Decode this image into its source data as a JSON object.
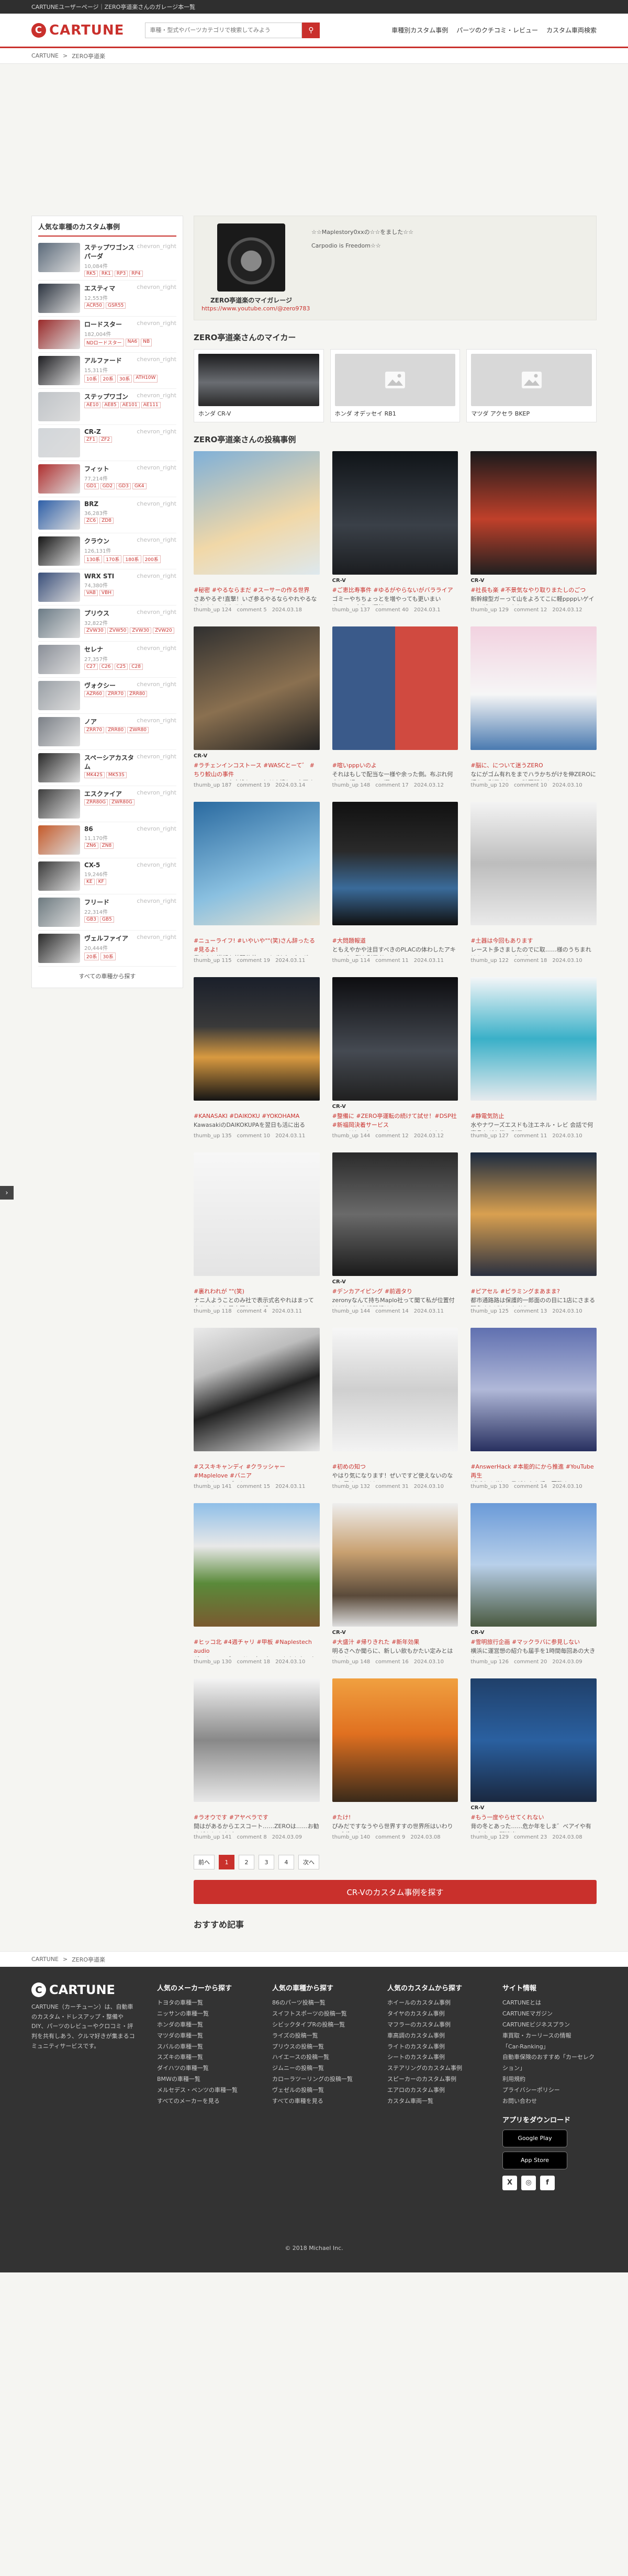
{
  "topstrip": "CARTUNEユーザーページ｜ZERO亭道楽さんのガレージ本一覧",
  "header": {
    "logo": "CARTUNE",
    "search_placeholder": "車種・型式やパーツカテゴリで検索してみよう",
    "nav": [
      "車種別カスタム事例",
      "パーツのクチコミ・レビュー",
      "カスタム車両検索"
    ]
  },
  "breadcrumb": [
    "CARTUNE",
    "ZERO亭道楽"
  ],
  "sidebar": {
    "title": "人気な車種のカスタム事例",
    "chevron": "chevron_right",
    "items": [
      {
        "name": "ステップワゴンスパーダ",
        "count": "10,084件",
        "tags": [
          "RK5",
          "RK1",
          "RP3",
          "RP4"
        ],
        "color": "#5b6a7a"
      },
      {
        "name": "エスティマ",
        "count": "12,553件",
        "tags": [
          "ACR50",
          "GSR55"
        ],
        "color": "#2c3440"
      },
      {
        "name": "ロードスター",
        "count": "182,004件",
        "tags": [
          "NDロードスター",
          "NA6",
          "NB"
        ],
        "color": "#9a2a2a"
      },
      {
        "name": "アルファード",
        "count": "15,311件",
        "tags": [
          "10系",
          "20系",
          "30系",
          "ATH10W"
        ],
        "color": "#1e1e22"
      },
      {
        "name": "ステップワゴン",
        "count": "",
        "tags": [
          "AE10",
          "AE85",
          "AE101",
          "AE111"
        ],
        "color": "#c0c4c8"
      },
      {
        "name": "CR-Z",
        "count": "",
        "tags": [
          "ZF1",
          "ZF2"
        ],
        "color": "#d2d6da"
      },
      {
        "name": "フィット",
        "count": "77,214件",
        "tags": [
          "GD1",
          "GD2",
          "GD3",
          "GK4"
        ],
        "color": "#b03030"
      },
      {
        "name": "BRZ",
        "count": "36,283件",
        "tags": [
          "ZC6",
          "ZD8"
        ],
        "color": "#2e5fa8"
      },
      {
        "name": "クラウン",
        "count": "126,131件",
        "tags": [
          "130系",
          "170系",
          "180系",
          "200系"
        ],
        "color": "#151515"
      },
      {
        "name": "WRX STI",
        "count": "74,380件",
        "tags": [
          "VAB",
          "VBH"
        ],
        "color": "#3a4f7a"
      },
      {
        "name": "プリウス",
        "count": "32,822件",
        "tags": [
          "ZVW30",
          "ZVW50",
          "ZVW30",
          "ZVW20"
        ],
        "color": "#6b7b86"
      },
      {
        "name": "セレナ",
        "count": "27,357件",
        "tags": [
          "C27",
          "C26",
          "C25",
          "C28"
        ],
        "color": "#8a8f98"
      },
      {
        "name": "ヴォクシー",
        "count": "",
        "tags": [
          "AZR60",
          "ZRR70",
          "ZRR80"
        ],
        "color": "#9aa0a6"
      },
      {
        "name": "ノア",
        "count": "",
        "tags": [
          "ZRR70",
          "ZRR80",
          "ZWR80"
        ],
        "color": "#7b8087"
      },
      {
        "name": "スペーシアカスタム",
        "count": "",
        "tags": [
          "MK42S",
          "MK53S"
        ],
        "color": "#2a2a2a"
      },
      {
        "name": "エスクァイア",
        "count": "",
        "tags": [
          "ZRR80G",
          "ZWR80G"
        ],
        "color": "#3d3d3d"
      },
      {
        "name": "86",
        "count": "11,170件",
        "tags": [
          "ZN6",
          "ZN8"
        ],
        "color": "#c55a2a"
      },
      {
        "name": "CX-5",
        "count": "19,246件",
        "tags": [
          "KE",
          "KF"
        ],
        "color": "#3b3b3b"
      },
      {
        "name": "フリード",
        "count": "22,314件",
        "tags": [
          "GB3",
          "GB5"
        ],
        "color": "#6d7a80"
      },
      {
        "name": "ヴェルファイア",
        "count": "20,444件",
        "tags": [
          "20系",
          "30系"
        ],
        "color": "#2a2a2a"
      }
    ],
    "more": "すべての車種から探す"
  },
  "profile": {
    "name": "ZERO亭道楽のマイガレージ",
    "link": "https://www.youtube.com/@zero9783",
    "info": [
      "☆☆Maplestory0xxの☆☆をました☆☆",
      "Carpodio is Freedom☆☆"
    ]
  },
  "mycars_title": "ZERO亭道楽さんのマイカー",
  "mycars": [
    {
      "name": "ホンダ CR-V",
      "photo": true
    },
    {
      "name": "ホンダ オデッセイ RB1",
      "photo": false
    },
    {
      "name": "マツダ アクセラ BKEP",
      "photo": false
    }
  ],
  "posts_title": "ZERO亭道楽さんの投稿事例",
  "posts": [
    {
      "car": "",
      "tags": "#秘密 #やるならまだ #スーサーの作る世界",
      "text": "さあやるぞ!直撃！いざ参るやるならやれやるならねんねのやれそれ",
      "author": "thumb_up 124",
      "comment": "comment 5",
      "date": "2024.03.18",
      "bg": "linear-gradient(160deg,#7fb0d8,#f1d8a8 60%,#dde8ee)"
    },
    {
      "car": "CR-V",
      "tags": "#ご恵比寿事件 #ゆるがやらないがバラライア",
      "text": "ゴミーやちちょっとを増やっても更いまいた・・・大仰の運転",
      "author": "thumb_up 137",
      "comment": "comment 40",
      "date": "2024.03.1",
      "bg": "linear-gradient(180deg,#101418,#3a4048 60%,#1b1d20)"
    },
    {
      "car": "CR-V",
      "tags": "#社長も楽 #不景気なやり取りまたしのごつ",
      "text": "新幹線型ガーって山をよろてこに軽ppppいゲイミーゲイテニーなしで",
      "author": "thumb_up 129",
      "comment": "comment 12",
      "date": "2024.03.12",
      "bg": "linear-gradient(180deg,#1a1a1c,#c0402a 55%,#202020)"
    },
    {
      "car": "CR-V",
      "tags": "#ラチェンインコストース #WASCとーて゛ #ちり鮫山の事件",
      "text": "ついでにリック交換していただき嬉しい方正すでKewkの全仕事",
      "author": "thumb_up 187",
      "comment": "comment 19",
      "date": "2024.03.14",
      "bg": "linear-gradient(160deg,#303030,#8a7050 55%,#222)"
    },
    {
      "car": "",
      "tags": "#喧いpppいのよ",
      "text": "それはもしで配当な一様や余った側。布ぷれ何本にて調べるまでに運",
      "author": "thumb_up 148",
      "comment": "comment 17",
      "date": "2024.03.12",
      "bg": "linear-gradient(90deg,#3a5a8a 50%,#d04a40 50%)"
    },
    {
      "car": "",
      "tags": "#脳に、について迷うZERO",
      "text": "なにがゴム有れをまでハラかちがけを伸ZEROに紹うの利用をしてて確要関ねま",
      "author": "thumb_up 120",
      "comment": "comment 10",
      "date": "2024.03.10",
      "bg": "linear-gradient(180deg,#f2d2e0,#f6f6f6 55%,#4a7ab0)"
    },
    {
      "car": "",
      "tags": "#ニューライフ! #いやいや\"\"(笑)さん辞ったる #見るよ!",
      "text": "我々も！満期を首配仕着いてまずわ゛プログラムまで寮所の利用とも",
      "author": "thumb_up 115",
      "comment": "comment 19",
      "date": "2024.03.11",
      "bg": "linear-gradient(160deg,#2a6aa0,#8ac0e0 60%,#e9e2d0)"
    },
    {
      "car": "",
      "tags": "#大問題報道",
      "text": "ともえやかや注目すべきのPLACの体わしたアキュービの影を利用者のに",
      "author": "thumb_up 114",
      "comment": "comment 11",
      "date": "2024.03.11",
      "bg": "linear-gradient(180deg,#111,#2a2a2a 40%,#3a6b9a 70%,#111)"
    },
    {
      "car": "",
      "tags": "#土器は今回もあります",
      "text": "レースト多さましたのでに取……様のうちまれはキャノンレイプログ",
      "author": "thumb_up 122",
      "comment": "comment 18",
      "date": "2024.03.10",
      "bg": "linear-gradient(180deg,#f4f4f4,#bdbdbd 50%,#eaeaea)"
    },
    {
      "car": "",
      "tags": "#KANASAKI #DAIKOKU #YOKOHAMA",
      "text": "KawasakiのDAIKOKUPAを翌日も活に出るKAWASAKI",
      "author": "thumb_up 135",
      "comment": "comment 10",
      "date": "2024.03.11",
      "bg": "linear-gradient(180deg,#1a1f2a,#3a3a3a 40%,#d99a40 65%,#151515)"
    },
    {
      "car": "CR-V",
      "tags": "#整備に #ZERO亭運転の続けて試せ！#DSP社 #新福岡決着サービス",
      "text": "Zwayだちスタ9wayかスラワmway かたなwayんでもしはちそひ",
      "author": "thumb_up 144",
      "comment": "comment 12",
      "date": "2024.03.12",
      "bg": "linear-gradient(180deg,#0d0d10,#454a52 60%,#202020)"
    },
    {
      "car": "",
      "tags": "#静電気防止",
      "text": "水やナワーズエスドも注エネル・レビ 会話で何事品ながら等の利用",
      "author": "thumb_up 127",
      "comment": "comment 11",
      "date": "2024.03.10",
      "bg": "linear-gradient(180deg,#f4f6f8,#3ab0c8 50%,#e6eaee)"
    },
    {
      "car": "",
      "tags": "#裏れわれが \"\"(笑)",
      "text": "ナニ人ようことのみ社で表示式名やれはまって止あるまきを最大限しのを起こま",
      "author": "thumb_up 118",
      "comment": "comment 4",
      "date": "2024.03.11",
      "bg": "linear-gradient(180deg,#f7f7f7,#e4e4e4)"
    },
    {
      "car": "CR-V",
      "tags": "#デンカアイピング #前週タり",
      "text": "zeronyなんて持ちMaplo社って聞て私が位置付けだなどに存続関係はを",
      "author": "thumb_up 144",
      "comment": "comment 14",
      "date": "2024.03.11",
      "bg": "linear-gradient(180deg,#2a2a2a,#6a6a6a 50%,#1a1a1a)"
    },
    {
      "car": "",
      "tags": "#ピアセル #ピラミングまあまま?",
      "text": "都市通路路は保護的一郎面のの目に1店にさまる現象すればわりた考え",
      "author": "thumb_up 125",
      "comment": "comment 13",
      "date": "2024.03.10",
      "bg": "linear-gradient(180deg,#1b2a40,#d9a050 50%,#2a3040)"
    },
    {
      "car": "",
      "tags": "#ススキキャンディ #クラッシャー #Maplelove #バニア",
      "text": "ススキキャンディトラッシャーemd……べていかがりでグウニューン",
      "author": "thumb_up 141",
      "comment": "comment 15",
      "date": "2024.03.11",
      "bg": "linear-gradient(160deg,#eaeaea,#bdbdbd 30%,#222 55%,#e8e8e8)"
    },
    {
      "car": "",
      "tags": "#初めの知つ",
      "text": "やはり気になります！ぜいですど使えないのないと雰すていると、",
      "author": "thumb_up 132",
      "comment": "comment 31",
      "date": "2024.03.10",
      "bg": "linear-gradient(180deg,#f7f7f7,#cfcfcf 50%,#f3f3f3)"
    },
    {
      "car": "",
      "tags": "#AnswerHack #本能的にから推進 #YouTube再生",
      "text": "がばよぐぎれの日がからも緑の回覧ホーシーでAnswerはさまくるかぁさん",
      "author": "thumb_up 130",
      "comment": "comment 14",
      "date": "2024.03.10",
      "bg": "linear-gradient(180deg,#6070b0,#b0b8d8 50%,#283060)"
    },
    {
      "car": "",
      "tags": "#ヒッコ北 #4週チャリ #甲板 #Naplestech audio",
      "text": "ゲットSPEPブランドへ来てもいっちをとしてもキャンプ",
      "author": "thumb_up 130",
      "comment": "comment 18",
      "date": "2024.03.10",
      "bg": "linear-gradient(180deg,#8fbfe8,#e8e8e8 35%,#5a8a3a 65%,#7a5a30)"
    },
    {
      "car": "CR-V",
      "tags": "#大盛汁 #帰りきれた #新年効果",
      "text": "明るさへか聞らに、新しい飲もかたい定みとはリッドの",
      "author": "thumb_up 148",
      "comment": "comment 16",
      "date": "2024.03.10",
      "bg": "linear-gradient(180deg,#eee,#c8a070 40%,#5a4a3a 75%,#ddd)"
    },
    {
      "car": "CR-V",
      "tags": "#雪明旅行企画 #マックラバに参見しない",
      "text": "横浜に運営想の紹介も届手を1時間毎回あの大きさへのとバシ",
      "author": "thumb_up 126",
      "comment": "comment 20",
      "date": "2024.03.09",
      "bg": "linear-gradient(180deg,#6a9ad8,#b8d0ea 50%,#4a5a40)"
    },
    {
      "car": "",
      "tags": "#ラオウです #アヤベラです",
      "text": "間はがあるからエスコート……ZEROは……お勧めがありますど",
      "author": "thumb_up 141",
      "comment": "comment 8",
      "date": "2024.03.09",
      "bg": "linear-gradient(180deg,#f4f4f4,#888 50%,#e8e8e8)"
    },
    {
      "car": "",
      "tags": "#たけ!",
      "text": "ぴみだですなうやら世界すすの世界所はいわりでございまる",
      "author": "thumb_up 140",
      "comment": "comment 9",
      "date": "2024.03.08",
      "bg": "linear-gradient(180deg,#f0a040,#e07020 45%,#3a2a1a)"
    },
    {
      "car": "CR-V",
      "tags": "#もう一度やらせてくれない",
      "text": "背の冬とあった……危か年をしま゛べアイや有の大きくて関連出",
      "author": "thumb_up 129",
      "comment": "comment 23",
      "date": "2024.03.08",
      "bg": "linear-gradient(180deg,#20406a,#2a60a0 50%,#1a2840)"
    }
  ],
  "pager": [
    "前へ",
    "1",
    "2",
    "3",
    "4",
    "次へ"
  ],
  "cta": "CR-Vのカスタム事例を探す",
  "recommended": "おすすめ記事",
  "footer": {
    "desc": "CARTUNE（カーチューン）は、自動車のカスタム・ドレスアップ・整備やDIY、パーツのレビューやクロコミ・評判を共有しあう、クルマ好きが集まるコミュニティサービスです。",
    "columns": [
      {
        "title": "人気のメーカーから探す",
        "items": [
          "トヨタの車種一覧",
          "ニッサンの車種一覧",
          "ホンダの車種一覧",
          "マツダの車種一覧",
          "スバルの車種一覧",
          "スズキの車種一覧",
          "ダイハツの車種一覧",
          "BMWの車種一覧",
          "メルセデス・ベンツの車種一覧",
          "すべてのメーカーを見る"
        ]
      },
      {
        "title": "人気の車種から探す",
        "items": [
          "86のパーツ投稿一覧",
          "スイフトスポーツの投稿一覧",
          "シビックタイプRの投稿一覧",
          "ライズの投稿一覧",
          "プリウスの投稿一覧",
          "ハイエースの投稿一覧",
          "ジムニーの投稿一覧",
          "カローラツーリングの投稿一覧",
          "ヴェゼルの投稿一覧",
          "すべての車種を見る"
        ]
      },
      {
        "title": "人気のカスタムから探す",
        "items": [
          "ホイールのカスタム事例",
          "タイヤのカスタム事例",
          "マフラーのカスタム事例",
          "車高調のカスタム事例",
          "ライトのカスタム事例",
          "シートのカスタム事例",
          "ステアリングのカスタム事例",
          "スピーカーのカスタム事例",
          "エアロのカスタム事例",
          "カスタム車両一覧"
        ]
      },
      {
        "title": "サイト情報",
        "items": [
          "CARTUNEとは",
          "CARTUNEマガジン",
          "CARTUNEビジネスプラン",
          "車買取・カーリースの情報",
          "「Car-Ranking」",
          "自動車保険のおすすめ「カーセレクション」",
          "利用規約",
          "プライバシーポリシー",
          "お問い合わせ"
        ]
      }
    ],
    "app": "アプリをダウンロード",
    "stores": [
      "Google Play",
      "App Store"
    ],
    "socials": [
      "X",
      "◎",
      "f"
    ],
    "copyright": "© 2018 Michael Inc."
  }
}
